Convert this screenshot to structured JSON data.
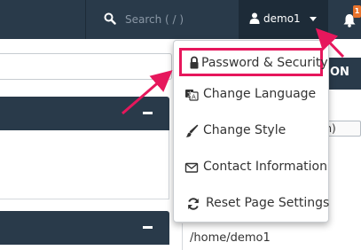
{
  "header": {
    "search": {
      "placeholder": "Search ( / )",
      "icon": "search-icon"
    },
    "user": {
      "name": "demo1",
      "icon": "user-icon",
      "caret_icon": "caret-down-icon"
    },
    "notifications": {
      "icon": "bell-icon",
      "count": "1"
    }
  },
  "user_dropdown": {
    "items": [
      {
        "label": "Password & Security",
        "icon": "lock-icon",
        "highlighted": true
      },
      {
        "label": "Change Language",
        "icon": "language-icon"
      },
      {
        "label": "Change Style",
        "icon": "paintbrush-icon"
      },
      {
        "label": "Contact Information",
        "icon": "envelope-icon"
      },
      {
        "label": "Reset Page Settings",
        "icon": "refresh-icon"
      }
    ]
  },
  "background": {
    "right_bar_label": "ON",
    "select_value": "om)",
    "home_path": "/home/demo1"
  },
  "annotations": {
    "arrow_color": "#e6175c"
  },
  "colors": {
    "nav": "#293a4a",
    "nav_dark": "#1d2b38",
    "accent": "#e6175c",
    "badge": "#e8732c"
  }
}
